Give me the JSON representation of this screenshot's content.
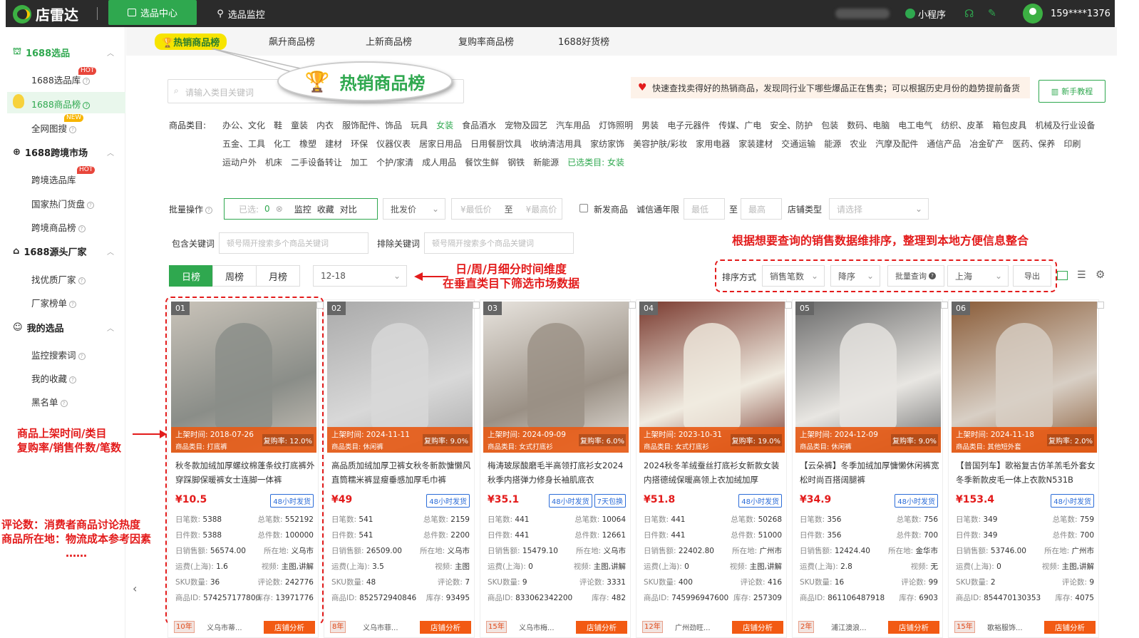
{
  "app": {
    "name": "店雷达"
  },
  "topnav": {
    "tab_active": "选品中心",
    "tab2": "选品监控",
    "mini": "小程序",
    "user": "159****1376"
  },
  "sidebar": {
    "g1": "1688选品",
    "g1_items": [
      "1688选品库",
      "1688商品榜",
      "全网图搜"
    ],
    "g2": "1688跨境市场",
    "g2_items": [
      "跨境选品库",
      "国家热门货盘",
      "跨境商品榜"
    ],
    "g3": "1688源头厂家",
    "g3_items": [
      "找优质厂家",
      "厂家榜单"
    ],
    "g4": "我的选品",
    "g4_items": [
      "监控搜索词",
      "我的收藏",
      "黑名单"
    ],
    "hot": "HOT",
    "new": "NEW"
  },
  "subtabs": [
    "热销商品榜",
    "飙升商品榜",
    "上新商品榜",
    "复购率商品榜",
    "1688好货榜"
  ],
  "bubble": "热销商品榜",
  "search": {
    "placeholder": "请输入类目关键词"
  },
  "notice": "快速查找卖得好的热销商品，发现同行业下哪些爆品正在售卖；可以根据历史月份的趋势提前备货",
  "tutorial": "新手教程",
  "category": {
    "label": "商品类目:",
    "row1": [
      "办公、文化",
      "鞋",
      "童装",
      "内衣",
      "服饰配件、饰品",
      "玩具",
      "女装",
      "食品酒水",
      "宠物及园艺",
      "汽车用品",
      "灯饰照明",
      "男装",
      "电子元器件",
      "传媒、广电",
      "安全、防护",
      "包装",
      "数码、电脑",
      "电工电气",
      "纺织、皮革",
      "箱包皮具",
      "机械及行业设备"
    ],
    "row2": [
      "五金、工具",
      "化工",
      "橡塑",
      "建材",
      "环保",
      "仪器仪表",
      "居家日用品",
      "日用餐厨饮具",
      "收纳清洁用具",
      "家纺家饰",
      "美容护肤/彩妆",
      "家用电器",
      "家装建材",
      "交通运输",
      "能源",
      "农业",
      "汽摩及配件",
      "通信产品",
      "冶金矿产",
      "医药、保养",
      "印刷"
    ],
    "row3": [
      "运动户外",
      "机床",
      "二手设备转让",
      "加工",
      "个护/家清",
      "成人用品",
      "餐饮生鲜",
      "钢铁",
      "新能源"
    ],
    "selected_label": "已选类目:",
    "selected": "女装"
  },
  "filters": {
    "batch": "批量操作",
    "selected": "已选:",
    "count": "0",
    "monitor": "监控",
    "fav": "收藏",
    "compare": "对比",
    "price_type": "批发价",
    "min_price": "¥最低价",
    "to": "至",
    "max_price": "¥最高价",
    "new_goods": "新发商品",
    "trust_years": "诚信通年限",
    "min": "最低",
    "max": "最高",
    "shop_type": "店铺类型",
    "please_select": "请选择",
    "include_kw": "包含关键词",
    "kw_ph": "顿号隔开搜索多个商品关键词",
    "exclude_kw": "排除关键词"
  },
  "rank": {
    "tabs": [
      "日榜",
      "周榜",
      "月榜"
    ],
    "date": "12-18"
  },
  "sort": {
    "label": "排序方式",
    "field": "销售笔数",
    "order": "降序",
    "batch": "批量查询",
    "region": "上海",
    "export": "导出"
  },
  "annotations": {
    "sort_note": "根据想要查询的销售数据维排序，整理到本地方便信息整合",
    "time_note1": "日/周/月细分时间维度",
    "time_note2": "在垂直类目下筛选市场数据",
    "left1a": "商品上架时间/类目",
    "left1b": "复购率/销售件数/笔数",
    "left2a": "评论数：消费者商品讨论热度",
    "left2b": "商品所在地：物流成本参考因素",
    "left2c": "……"
  },
  "labels": {
    "list_time": "上架时间:",
    "list_cat": "商品类目:",
    "repurchase": "复购率:",
    "day_orders": "日笔数:",
    "total_orders": "总笔数:",
    "day_pieces": "日件数:",
    "total_pieces": "总件数:",
    "day_sales": "日销售额:",
    "location": "所在地:",
    "freight": "运费(上海):",
    "video": "视频:",
    "sku": "SKU数量:",
    "reviews": "评论数:",
    "item_id": "商品ID:",
    "stock": "库存:",
    "shop_btn": "店铺分析",
    "ship48": "48小时发货"
  },
  "products": [
    {
      "no": "01",
      "date": "2018-07-26",
      "cat": "打底裤",
      "rep": "12.0%",
      "title": "秋冬款加绒加厚螺纹棉蓬条纹打底裤外穿踩脚保暖裤女士连脚一体裤",
      "price": "¥10.5",
      "tags": [
        "48小时发货"
      ],
      "day_orders": "5388",
      "total_orders": "552192",
      "day_pieces": "5388",
      "total_pieces": "100000",
      "day_sales": "56574.00",
      "loc": "义乌市",
      "freight": "1.6",
      "video": "主图,讲解",
      "sku": "36",
      "reviews": "242776",
      "id": "574257177800",
      "stock": "13971776",
      "years": "10年",
      "shop": "义乌市蒂..."
    },
    {
      "no": "02",
      "date": "2024-11-11",
      "cat": "休闲裤",
      "rep": "9.0%",
      "title": "高品质加绒加厚卫裤女秋冬新款慵懒风直筒糯米裤显瘦垂感加厚毛巾裤",
      "price": "¥49",
      "tags": [
        "48小时发货"
      ],
      "day_orders": "541",
      "total_orders": "2159",
      "day_pieces": "541",
      "total_pieces": "2200",
      "day_sales": "26509.00",
      "loc": "义乌市",
      "freight": "3.5",
      "video": "主图",
      "sku": "48",
      "reviews": "7",
      "id": "852572940846",
      "stock": "93495",
      "years": "8年",
      "shop": "义乌市菲..."
    },
    {
      "no": "03",
      "date": "2024-09-09",
      "cat": "女式打底衫",
      "rep": "6.0%",
      "title": "梅涛玻尿酸磨毛半高领打底衫女2024秋季内搭弹力修身长袖肌底衣",
      "price": "¥35.1",
      "tags": [
        "48小时发货",
        "7天包换"
      ],
      "day_orders": "441",
      "total_orders": "10064",
      "day_pieces": "441",
      "total_pieces": "12661",
      "day_sales": "15479.10",
      "loc": "义乌市",
      "freight": "0",
      "video": "主图,讲解",
      "sku": "9",
      "reviews": "3331",
      "id": "833062342200",
      "stock": "482",
      "years": "15年",
      "shop": "义乌市梅..."
    },
    {
      "no": "04",
      "date": "2023-10-31",
      "cat": "女式打底衫",
      "rep": "19.0%",
      "title": "2024秋冬羊绒蚕丝打底衫女新款女装内搭德绒保暖高领上衣加绒加厚",
      "price": "¥51.8",
      "tags": [
        "48小时发货"
      ],
      "day_orders": "441",
      "total_orders": "50268",
      "day_pieces": "441",
      "total_pieces": "51000",
      "day_sales": "22402.80",
      "loc": "广州市",
      "freight": "0",
      "video": "主图,讲解",
      "sku": "400",
      "reviews": "416",
      "id": "745996947600",
      "stock": "257309",
      "years": "12年",
      "shop": "广州劲旺..."
    },
    {
      "no": "05",
      "date": "2024-12-09",
      "cat": "休闲裤",
      "rep": "9.0%",
      "title": "【云朵裤】冬季加绒加厚慵懒休闲裤宽松时尚百搭阔腿裤",
      "price": "¥34.9",
      "tags": [
        "48小时发货"
      ],
      "day_orders": "356",
      "total_orders": "756",
      "day_pieces": "356",
      "total_pieces": "700",
      "day_sales": "12424.40",
      "loc": "金华市",
      "freight": "2.8",
      "video": "无",
      "sku": "16",
      "reviews": "99",
      "id": "861106487918",
      "stock": "6903",
      "years": "2年",
      "shop": "浦江澳浪..."
    },
    {
      "no": "06",
      "date": "2024-11-18",
      "cat": "其他短外套",
      "rep": "2.0%",
      "title": "【普国列车】歌裕复古仿羊羔毛外套女冬季新款皮毛一体上衣款N531B",
      "price": "¥153.4",
      "tags": [
        "48小时发货"
      ],
      "day_orders": "349",
      "total_orders": "759",
      "day_pieces": "349",
      "total_pieces": "700",
      "day_sales": "53746.00",
      "loc": "广州市",
      "freight": "0",
      "video": "主图,讲解",
      "sku": "2",
      "reviews": "9",
      "id": "854470130353",
      "stock": "4075",
      "years": "15年",
      "shop": "歌裕服饰..."
    }
  ]
}
